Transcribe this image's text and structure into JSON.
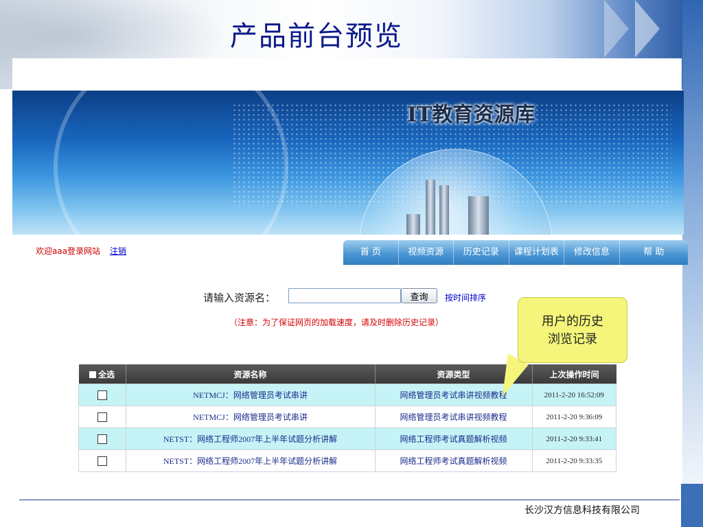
{
  "slide": {
    "title": "产品前台预览",
    "footer": "长沙汉方信息科技有限公司"
  },
  "site": {
    "banner_title": "IT教育资源库",
    "welcome": "欢迎aaa登录网站",
    "logout": "注销",
    "nav": [
      {
        "label": "首 页"
      },
      {
        "label": "视频资源"
      },
      {
        "label": "历史记录"
      },
      {
        "label": "课程计划表"
      },
      {
        "label": "修改信息"
      },
      {
        "label": "帮 助"
      }
    ],
    "search": {
      "label": "请输入资源名：",
      "value": "",
      "button": "查询",
      "sort_link": "按时间排序"
    },
    "notice": "（注意：为了保证网页的加载速度，请及时删除历史记录）",
    "callout": {
      "line1": "用户的历史",
      "line2": "浏览记录"
    },
    "table": {
      "headers": {
        "select_all": "全选",
        "name": "资源名称",
        "type": "资源类型",
        "time": "上次操作时间"
      },
      "rows": [
        {
          "name": "NETMCJ：网络管理员考试串讲",
          "type": "网络管理员考试串讲视频教程",
          "time": "2011-2-20 16:52:09"
        },
        {
          "name": "NETMCJ：网络管理员考试串讲",
          "type": "网络管理员考试串讲视频教程",
          "time": "2011-2-20 9:36:09"
        },
        {
          "name": "NETST：网络工程师2007年上半年试题分析讲解",
          "type": "网络工程师考试真题解析视频",
          "time": "2011-2-20 9:33:41"
        },
        {
          "name": "NETST：网络工程师2007年上半年试题分析讲解",
          "type": "网络工程师考试真题解析视频",
          "time": "2011-2-20 9:33:35"
        }
      ]
    }
  }
}
